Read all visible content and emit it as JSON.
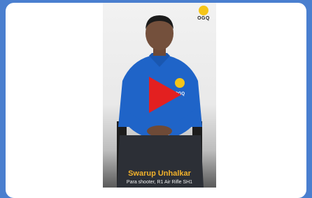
{
  "colors": {
    "background": "#4a7fcf",
    "card": "#ffffff",
    "accent_play": "#e32020",
    "name_color": "#f2b12b",
    "logo_color": "#f5c518"
  },
  "logo": {
    "text": "OGQ",
    "icon": "ogq-logo-icon"
  },
  "jersey_logo": {
    "text": "OGQ"
  },
  "play": {
    "icon": "play-icon"
  },
  "caption": {
    "name": "Swarup Unhalkar",
    "role": "Para shooter, R1 Air Rifle SH1"
  }
}
